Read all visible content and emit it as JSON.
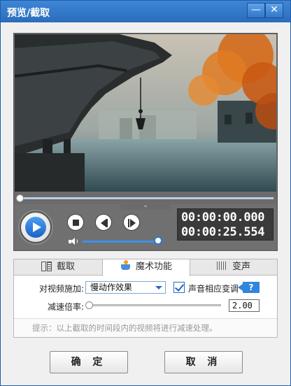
{
  "window": {
    "title": "预览/截取",
    "minimize_label": "—",
    "close_label": "✕"
  },
  "player": {
    "current_time": "00:00:00.000",
    "total_time": "00:00:25.554",
    "progress_fraction": 0.0,
    "volume_fraction": 1.0,
    "expand_label": "⌄"
  },
  "tabs": [
    {
      "label": "截取",
      "icon": "film-cut-icon",
      "active": false
    },
    {
      "label": "魔术功能",
      "icon": "magic-hat-icon",
      "active": true
    },
    {
      "label": "变声",
      "icon": "waveform-icon",
      "active": false
    }
  ],
  "magic": {
    "apply_label": "对视频施加:",
    "effect_selected": "慢动作效果",
    "pitch_label": "声音相应变调",
    "pitch_checked": true,
    "help_label": "?",
    "speed_label": "减速倍率:",
    "speed_value": "2.00",
    "hint": "提示：以上截取的时间段内的视频将进行减速处理。"
  },
  "buttons": {
    "ok": "确 定",
    "cancel": "取 消"
  },
  "colors": {
    "titlebar": "#3a7fd0",
    "accent": "#2f86dc",
    "timecode_bg": "#3a3a3a"
  }
}
